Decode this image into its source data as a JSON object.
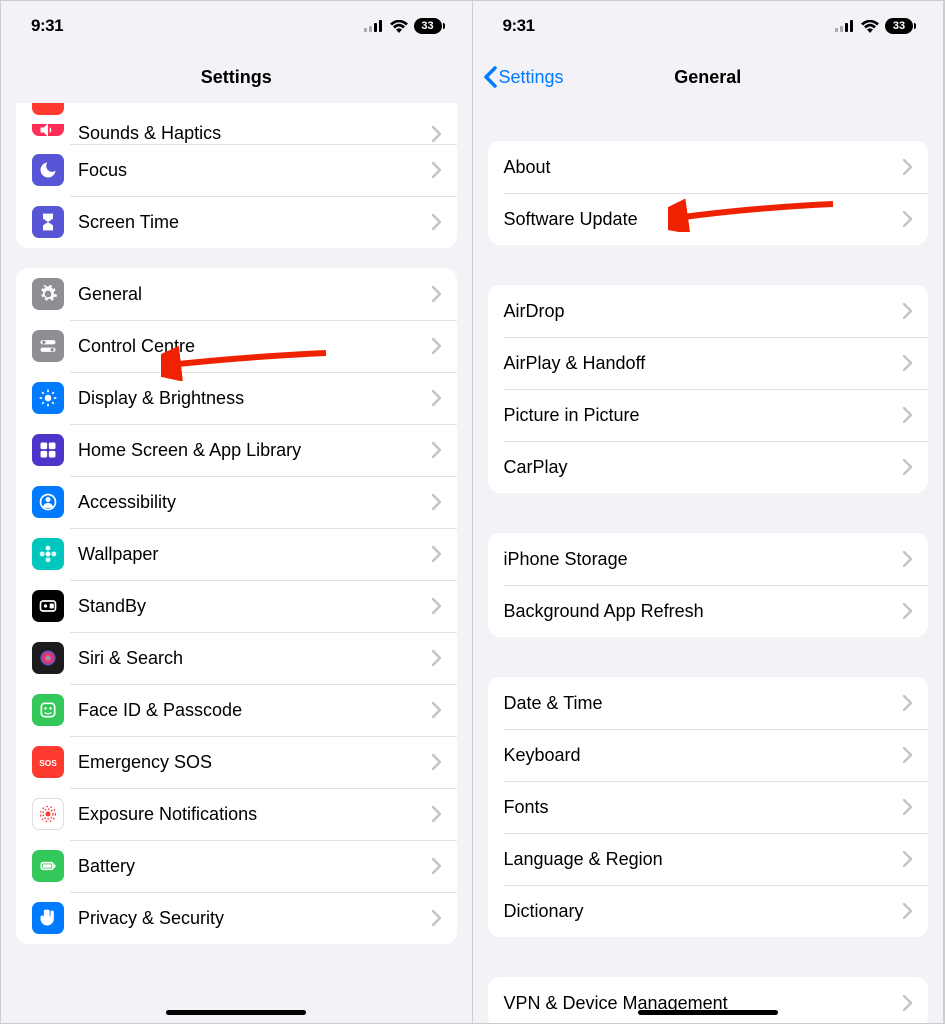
{
  "status": {
    "time": "9:31",
    "battery": "33"
  },
  "left": {
    "title": "Settings",
    "partial_row": {
      "icon_bg": "#ff3b30"
    },
    "group1": [
      {
        "label": "Sounds & Haptics",
        "icon": "speaker",
        "bg": "#ff2d55",
        "name": "sounds-haptics"
      },
      {
        "label": "Focus",
        "icon": "moon",
        "bg": "#5856d6",
        "name": "focus"
      },
      {
        "label": "Screen Time",
        "icon": "hourglass",
        "bg": "#5856d6",
        "name": "screen-time"
      }
    ],
    "group2": [
      {
        "label": "General",
        "icon": "gear",
        "bg": "#8e8e93",
        "name": "general",
        "arrow": true
      },
      {
        "label": "Control Centre",
        "icon": "switches",
        "bg": "#8e8e93",
        "name": "control-centre"
      },
      {
        "label": "Display & Brightness",
        "icon": "sun",
        "bg": "#007aff",
        "name": "display-brightness"
      },
      {
        "label": "Home Screen & App Library",
        "icon": "grid",
        "bg": "#4b36c9",
        "name": "home-screen"
      },
      {
        "label": "Accessibility",
        "icon": "person",
        "bg": "#007aff",
        "name": "accessibility"
      },
      {
        "label": "Wallpaper",
        "icon": "flower",
        "bg": "#00c7be",
        "name": "wallpaper"
      },
      {
        "label": "StandBy",
        "icon": "clock",
        "bg": "#000000",
        "name": "standby"
      },
      {
        "label": "Siri & Search",
        "icon": "siri",
        "bg": "#1c1c1e",
        "name": "siri-search"
      },
      {
        "label": "Face ID & Passcode",
        "icon": "face",
        "bg": "#34c759",
        "name": "faceid"
      },
      {
        "label": "Emergency SOS",
        "icon": "sos",
        "bg": "#ff3b30",
        "name": "emergency-sos"
      },
      {
        "label": "Exposure Notifications",
        "icon": "exposure",
        "bg": "#ffffff",
        "name": "exposure",
        "textcolor": "#ff3b30"
      },
      {
        "label": "Battery",
        "icon": "battery",
        "bg": "#34c759",
        "name": "battery"
      },
      {
        "label": "Privacy & Security",
        "icon": "hand",
        "bg": "#007aff",
        "name": "privacy"
      }
    ]
  },
  "right": {
    "back": "Settings",
    "title": "General",
    "group1": [
      {
        "label": "About",
        "name": "about"
      },
      {
        "label": "Software Update",
        "name": "software-update",
        "arrow": true
      }
    ],
    "group2": [
      {
        "label": "AirDrop",
        "name": "airdrop"
      },
      {
        "label": "AirPlay & Handoff",
        "name": "airplay-handoff"
      },
      {
        "label": "Picture in Picture",
        "name": "pip"
      },
      {
        "label": "CarPlay",
        "name": "carplay"
      }
    ],
    "group3": [
      {
        "label": "iPhone Storage",
        "name": "iphone-storage"
      },
      {
        "label": "Background App Refresh",
        "name": "bg-app-refresh"
      }
    ],
    "group4": [
      {
        "label": "Date & Time",
        "name": "date-time"
      },
      {
        "label": "Keyboard",
        "name": "keyboard"
      },
      {
        "label": "Fonts",
        "name": "fonts"
      },
      {
        "label": "Language & Region",
        "name": "language-region"
      },
      {
        "label": "Dictionary",
        "name": "dictionary"
      }
    ],
    "group5": [
      {
        "label": "VPN & Device Management",
        "name": "vpn-device-management"
      }
    ]
  }
}
